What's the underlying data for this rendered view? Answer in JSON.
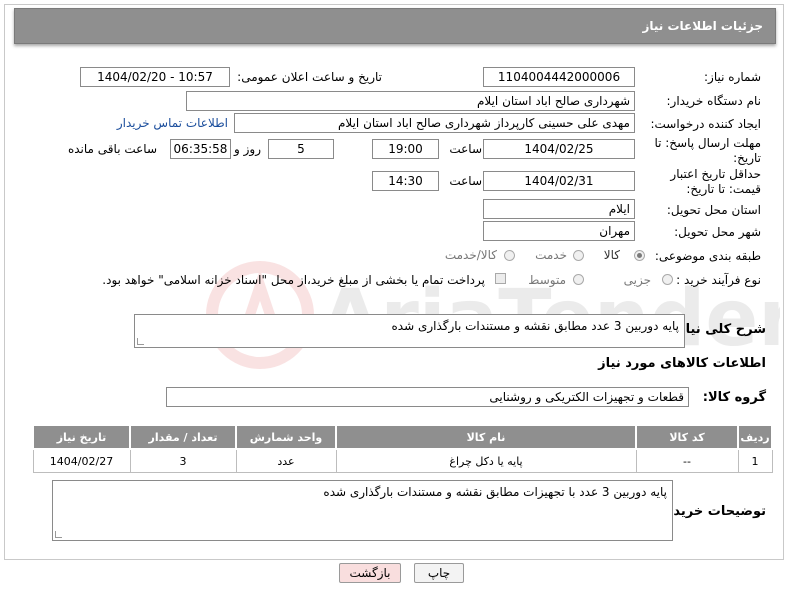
{
  "header": {
    "title": "جزئیات اطلاعات نیاز"
  },
  "fields": {
    "need_number_label": "شماره نیاز:",
    "need_number": "1104004442000006",
    "announce_label": "تاریخ و ساعت اعلان عمومی:",
    "announce_value": "1404/02/20 - 10:57",
    "buyer_org_label": "نام دستگاه خریدار:",
    "buyer_org": "شهرداری صالح اباد استان ایلام",
    "creator_label": "ایجاد کننده درخواست:",
    "creator": "مهدی علی حسینی کارپرداز شهرداری صالح اباد استان ایلام",
    "contact_link": "اطلاعات تماس خریدار",
    "reply_deadline_label": "مهلت ارسال پاسخ: تا تاریخ:",
    "reply_date": "1404/02/25",
    "time_label": "ساعت",
    "reply_time": "19:00",
    "days": "5",
    "days_label": "روز و",
    "remaining": "06:35:58",
    "remaining_label": "ساعت باقی مانده",
    "price_validity_label": "حداقل تاریخ اعتبار قیمت: تا تاریخ:",
    "price_date": "1404/02/31",
    "price_time_label": "ساعت",
    "price_time": "14:30",
    "province_label": "استان محل تحویل:",
    "province": "ایلام",
    "city_label": "شهر محل تحویل:",
    "city": "مهران",
    "category_label": "طبقه بندی موضوعی:",
    "category_options": [
      "کالا",
      "خدمت",
      "کالا/خدمت"
    ],
    "process_label": "نوع فرآیند خرید :",
    "process_options": [
      "جزیی",
      "متوسط"
    ],
    "payment_note": "پرداخت تمام یا بخشی از مبلغ خرید،از محل \"اسناد خزانه اسلامی\" خواهد بود."
  },
  "description": {
    "label": "شرح کلی نیاز:",
    "text": "پایه دوربین 3 عدد مطابق نقشه و مستندات بارگذاری شده"
  },
  "goods": {
    "section_title": "اطلاعات کالاهای مورد نیاز",
    "group_label": "گروه کالا:",
    "group_value": "قطعات و تجهیزات الکتریکی و روشنایی",
    "columns": [
      "ردیف",
      "کد کالا",
      "نام کالا",
      "واحد شمارش",
      "تعداد / مقدار",
      "تاریخ نیاز"
    ],
    "rows": [
      {
        "row": "1",
        "code": "--",
        "name": "پایه یا دکل چراغ",
        "unit": "عدد",
        "qty": "3",
        "date": "1404/02/27"
      }
    ]
  },
  "buyer_notes": {
    "label": "توضیحات خریدار:",
    "text": "پایه دوربین 3 عدد با تجهیزات  مطابق نقشه و مستندات بارگذاری شده"
  },
  "buttons": {
    "print": "چاپ",
    "back": "بازگشت"
  },
  "colors": {
    "header_bg": "#8f8f8f",
    "link": "#1a4d9c",
    "back_button_bg": "#f9dede"
  }
}
